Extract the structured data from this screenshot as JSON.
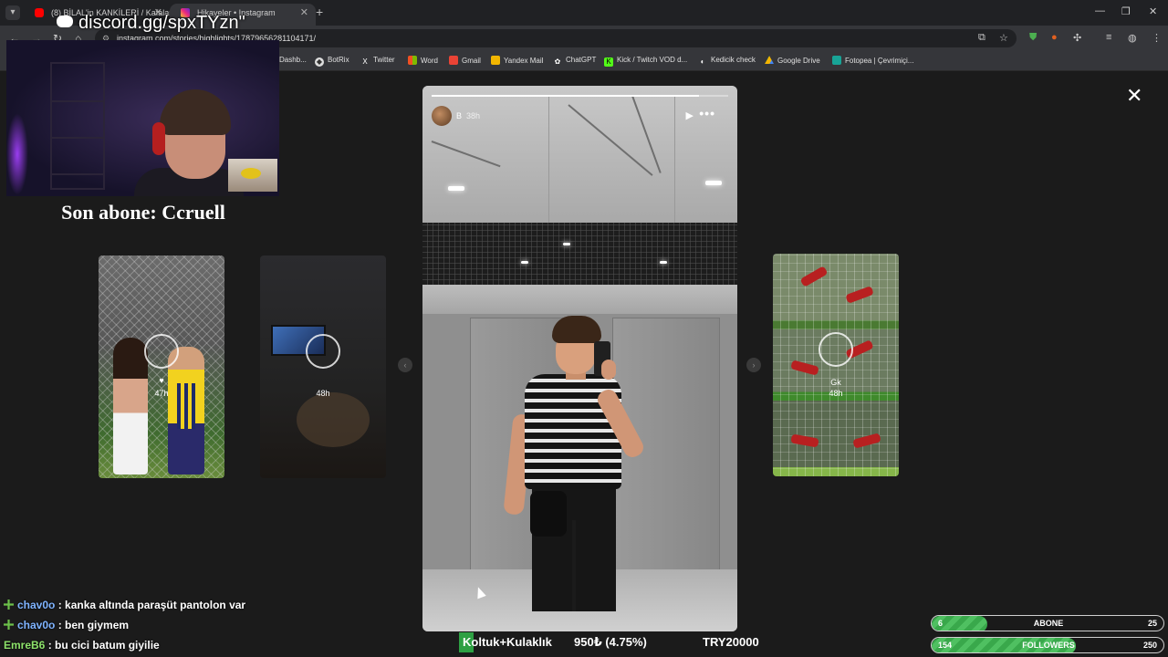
{
  "browser": {
    "tabs": [
      {
        "title": "(8) BİLAL'in KANKİLERİ / Kafalar",
        "active": false
      },
      {
        "title": "Hikayeler • Instagram",
        "active": true
      }
    ],
    "url": "instagram.com/stories/highlights/17879656281104171/",
    "bookmarks": [
      "Dashb...",
      "BotRix",
      "Twitter",
      "Word",
      "Gmail",
      "Yandex Mail",
      "ChatGPT",
      "Kick / Twitch VOD d...",
      "Kedicik check",
      "Google Drive",
      "Fotopea | Çevrimiçi..."
    ]
  },
  "story": {
    "username": "B",
    "time": "38h",
    "progress": 0.9
  },
  "cards": [
    {
      "time": "47h"
    },
    {
      "time": "48h"
    },
    {
      "title": "Gk",
      "time": "48h"
    }
  ],
  "overlay": {
    "discord": "discord.gg/spxTYzn\"",
    "last_sub": "Son abone: Ccruell",
    "chat": [
      {
        "user": "chav0o",
        "message": ": kanka altında paraşüt pantolon var",
        "color": "blue"
      },
      {
        "user": "chav0o",
        "message": ": ben giymem",
        "color": "blue"
      },
      {
        "user": "EmreB6",
        "message": ": bu cici batum giyilie",
        "color": "green"
      }
    ],
    "goal": {
      "item": "Koltuk+Kulaklık",
      "amount": "950₺ (4.75%)",
      "target": "TRY20000",
      "progress": 0.0475
    },
    "sub_goal": {
      "current": "6",
      "label": "ABONE",
      "max": "25",
      "progress": 0.24
    },
    "follower_goal": {
      "current": "154",
      "label": "FOLLOWERS",
      "max": "250",
      "progress": 0.616
    }
  },
  "colors": {
    "accent_green": "#39a84b",
    "chat_blue": "#7fb4ff",
    "chat_green": "#8ee36b"
  }
}
